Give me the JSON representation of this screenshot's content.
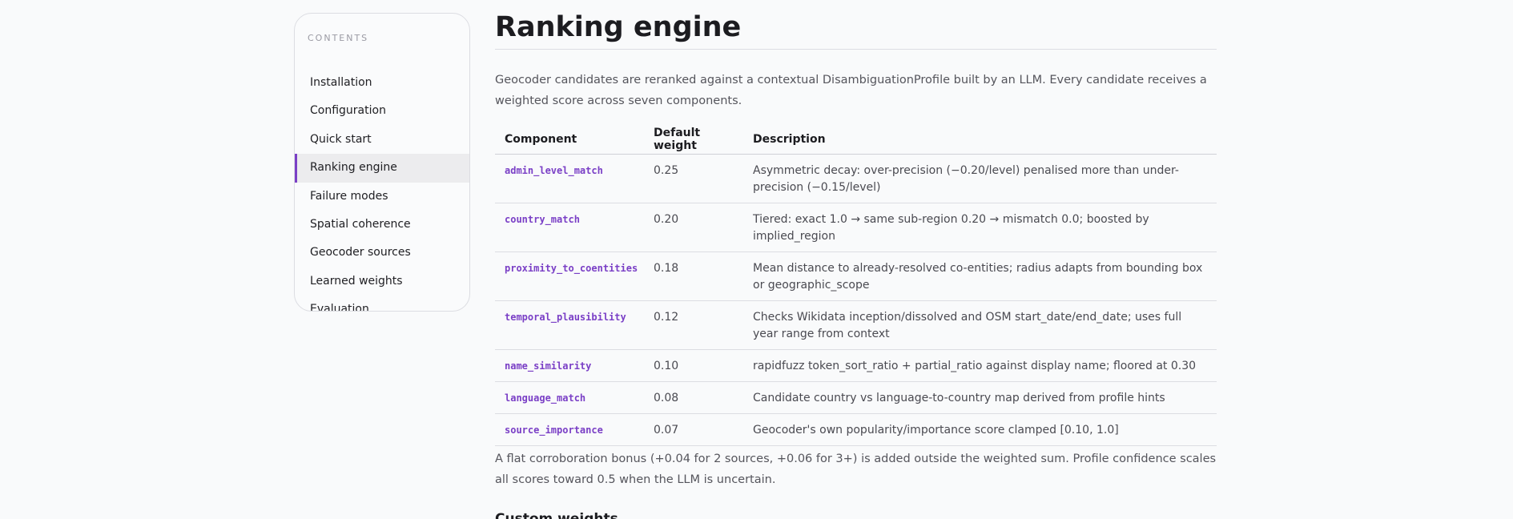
{
  "toc": {
    "heading": "CONTENTS",
    "items": [
      {
        "label": "Installation"
      },
      {
        "label": "Configuration"
      },
      {
        "label": "Quick start"
      },
      {
        "label": "Ranking engine",
        "active": true
      },
      {
        "label": "Failure modes"
      },
      {
        "label": "Spatial coherence"
      },
      {
        "label": "Geocoder sources"
      },
      {
        "label": "Learned weights"
      },
      {
        "label": "Evaluation"
      }
    ]
  },
  "main": {
    "title": "Ranking engine",
    "intro": "Geocoder candidates are reranked against a contextual DisambiguationProfile built by an LLM. Every candidate receives a weighted score across seven components.",
    "table": {
      "headers": [
        "Component",
        "Default weight",
        "Description"
      ],
      "rows": [
        {
          "component": "admin_level_match",
          "weight": "0.25",
          "description": "Asymmetric decay: over-precision (−0.20/level) penalised more than under-precision (−0.15/level)"
        },
        {
          "component": "country_match",
          "weight": "0.20",
          "description": "Tiered: exact 1.0 → same sub-region 0.20 → mismatch 0.0; boosted by implied_region"
        },
        {
          "component": "proximity_to_coentities",
          "weight": "0.18",
          "description": "Mean distance to already-resolved co-entities; radius adapts from bounding box or geographic_scope"
        },
        {
          "component": "temporal_plausibility",
          "weight": "0.12",
          "description": "Checks Wikidata inception/dissolved and OSM start_date/end_date; uses full year range from context"
        },
        {
          "component": "name_similarity",
          "weight": "0.10",
          "description": "rapidfuzz token_sort_ratio + partial_ratio against display name; floored at 0.30"
        },
        {
          "component": "language_match",
          "weight": "0.08",
          "description": "Candidate country vs language-to-country map derived from profile hints"
        },
        {
          "component": "source_importance",
          "weight": "0.07",
          "description": "Geocoder's own popularity/importance score clamped [0.10, 1.0]"
        }
      ]
    },
    "footnote": "A flat corroboration bonus (+0.04 for 2 sources, +0.06 for 3+) is added outside the weighted sum. Profile confidence scales all scores toward 0.5 when the LLM is uncertain.",
    "next_heading": "Custom weights"
  },
  "colors": {
    "accent": "#7a3fc6",
    "background": "#f9fafb",
    "border": "#dcdde2"
  }
}
